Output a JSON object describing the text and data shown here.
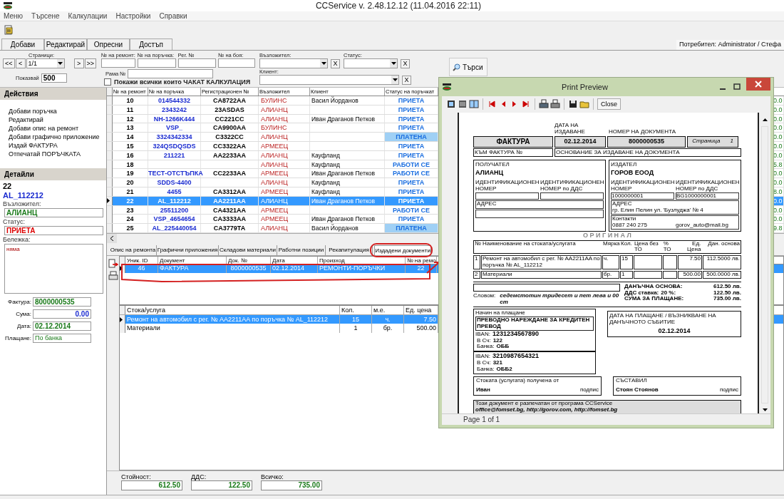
{
  "window": {
    "title": "CCService v. 2.48.12.12 (11.04.2016 22:11)"
  },
  "menu": [
    "Меню",
    "Търсене",
    "Калкулации",
    "Настройки",
    "Справки"
  ],
  "toolbar_tabs": [
    {
      "label": "Добави",
      "selected": false
    },
    {
      "label": "Редактирай",
      "selected": false
    },
    {
      "label": "Опресни",
      "selected": false
    },
    {
      "label": "Достъп",
      "selected": false
    }
  ],
  "user": "Потребител: Administrator / Стефа",
  "filter": {
    "pages_label": "Страници:",
    "page": "1/1",
    "nav": [
      "<<",
      "<",
      ">",
      ">>"
    ],
    "show_label": "Показвай",
    "show": "500",
    "repair_label": "№ на ремонт:",
    "order_label": "№ на поръчка:",
    "reg_label": "Рег. №",
    "paint_label": "№ на боя:",
    "frame_label": "Рама №",
    "assignor_label": "Възложител:",
    "assignor_clear": "X",
    "status_label": "Статус:",
    "status_clear": "X",
    "client_label": "Клиент:",
    "client_clear": "X",
    "waiting": {
      "label": "Покажи всички които ЧАКАТ КАЛКУЛАЦИЯ",
      "checked": false
    },
    "search": "Търси"
  },
  "actions": {
    "title": "Действия",
    "items": [
      "Добави поръчка",
      "Редактирай",
      "Добави опис на ремонт",
      "Добави графично приложение",
      "Издай ФАКТУРА",
      "Отпечатай ПОРЪЧКАТА"
    ]
  },
  "details": {
    "title": "Детайли",
    "repair": "22",
    "order": "AL_112212",
    "assignor_label": "Възложител:",
    "assignor": "АЛИАНЦ",
    "status_label": "Статус:",
    "status": "ПРИЕТА",
    "note_label": "Бележка:",
    "note": "няма",
    "fields": [
      {
        "label": "Фактура:",
        "value": "8000000535",
        "kind": "green"
      },
      {
        "label": "Сума:",
        "value": "0.00",
        "kind": "amount"
      },
      {
        "label": "Дата:",
        "value": "02.12.2014",
        "kind": "green"
      },
      {
        "label": "Плащане:",
        "value": "По банка",
        "kind": "plain"
      }
    ]
  },
  "table": {
    "columns": [
      "№ на ремонт",
      "№ на поръчка",
      "Регистрационен №",
      "Възложител",
      "Клиент",
      "Статус на поръчкат"
    ],
    "rows": [
      {
        "repair": "10",
        "order": "014544332",
        "reg": "CA8722AA",
        "assignor": "БУЛИНС",
        "client": "Васил Йорданов",
        "status": "ПРИЕТА",
        "status_shaded": false,
        "selected": false,
        "column_8": "0.0"
      },
      {
        "repair": "11",
        "order": "2343242",
        "reg": "23ASDAS",
        "assignor": "АЛИАНЦ",
        "status": "ПРИЕТА",
        "status_shaded": false,
        "selected": false,
        "column_8": "0.0"
      },
      {
        "repair": "12",
        "order": "NH-1266K444",
        "reg": "CC221CC",
        "assignor": "АЛИАНЦ",
        "client": "Иван Драганов Петков",
        "status": "ПРИЕТА",
        "status_shaded": false,
        "selected": false,
        "column_8": "0.0"
      },
      {
        "repair": "13",
        "order": "VSP_",
        "reg": "CA9900AA",
        "assignor": "БУЛИНС",
        "status": "ПРИЕТА",
        "status_shaded": false,
        "selected": false,
        "column_8": "0.0"
      },
      {
        "repair": "14",
        "order": "3324342334",
        "reg": "C3322CC",
        "assignor": "АЛИАНЦ",
        "status": "ПЛАТЕНА",
        "status_shaded": true,
        "selected": false,
        "column_8": "0.0"
      },
      {
        "repair": "15",
        "order": "324QSDQSDS",
        "reg": "CC3322AA",
        "assignor": "АРМЕЕЦ",
        "status": "ПРИЕТА",
        "status_shaded": false,
        "selected": false,
        "column_8": "0.0"
      },
      {
        "repair": "16",
        "order": "211221",
        "reg": "AA2233AA",
        "assignor": "АЛИАНЦ",
        "client": "Кауфланд",
        "status": "ПРИЕТА",
        "status_shaded": false,
        "selected": false,
        "column_8": "0.0"
      },
      {
        "repair": "18",
        "assignor": "АЛИАНЦ",
        "client": "Кауфланд",
        "status": "РАБОТИ СЕ",
        "status_shaded": false,
        "selected": false,
        "column_8": "5.8"
      },
      {
        "repair": "19",
        "order": "ТЕСТ-ОТСТЪПКА",
        "reg": "CC2233AA",
        "assignor": "АРМЕЕЦ",
        "client": "Иван Драганов Петков",
        "status": "РАБОТИ СЕ",
        "status_shaded": false,
        "selected": false,
        "column_8": "0.0"
      },
      {
        "repair": "20",
        "order": "SDDS-4400",
        "assignor": "АЛИАНЦ",
        "client": "Кауфланд",
        "status": "ПРИЕТА",
        "status_shaded": false,
        "selected": false,
        "column_8": "0.0"
      },
      {
        "repair": "21",
        "order": "4455",
        "reg": "CA3312AA",
        "assignor": "АРМЕЕЦ",
        "client": "Кауфланд",
        "status": "ПРИЕТА",
        "status_shaded": false,
        "selected": false,
        "column_8": "8.0"
      },
      {
        "repair": "22",
        "order": "AL_112212",
        "reg": "AA2211AA",
        "assignor": "АЛИАНЦ",
        "client": "Иван Драганов Петков",
        "status": "ПРИЕТА",
        "status_shaded": false,
        "selected": true,
        "column_8": "0.0"
      },
      {
        "repair": "23",
        "order": "25511200",
        "reg": "CA4321AA",
        "assignor": "АРМЕЕЦ",
        "status": "РАБОТИ СЕ",
        "status_shaded": false,
        "selected": false,
        "column_8": "0.0"
      },
      {
        "repair": "24",
        "order": "VSP_4654654",
        "reg": "CA3333AA",
        "assignor": "АРМЕЕЦ",
        "client": "Иван Драганов Петков",
        "status": "ПРИЕТА",
        "status_shaded": false,
        "selected": false,
        "column_8": "0.0"
      },
      {
        "repair": "25",
        "order": "AL_225440054",
        "reg": "CA3779TA",
        "assignor": "АЛИАНЦ",
        "client": "Васил Йорданов",
        "status": "ПЛАТЕНА",
        "status_shaded": true,
        "selected": false,
        "column_8": "9.8"
      }
    ]
  },
  "subtabs": [
    {
      "label": "Опис на ремонта",
      "selected": false
    },
    {
      "label": "Графични приложения",
      "selected": false
    },
    {
      "label": "Складови материали",
      "selected": false
    },
    {
      "label": "Работни позиции",
      "selected": false
    },
    {
      "label": "Рекапитулация",
      "selected": false
    },
    {
      "label": "Издадени документи",
      "selected": true
    }
  ],
  "documents": {
    "columns": [
      "Уник. ID",
      "Документ",
      "Док. №",
      "Дата",
      "Произход",
      "№ на ремо"
    ],
    "rows": [
      {
        "cells": [
          "46",
          "ФАКТУРА",
          "8000000535",
          "02.12.2014",
          "РЕМОНТИ-ПОРЪЧКИ",
          "22"
        ],
        "selected": true
      }
    ]
  },
  "items": {
    "columns": [
      "Стока/услуга",
      "Кол.",
      "м.е.",
      "Ед. цена"
    ],
    "rows": [
      {
        "cells": [
          "Ремонт на автомобил с рег. № AA2211AA по поръчка № AL_112212",
          "15",
          "ч.",
          "7.50"
        ],
        "selected": true
      },
      {
        "cells": [
          "Материали",
          "1",
          "бр.",
          "500.00"
        ],
        "selected": false
      }
    ]
  },
  "totals": [
    {
      "label": "Стойност:",
      "value": "612.50"
    },
    {
      "label": "ДДС:",
      "value": "122.50"
    },
    {
      "label": "Всичко:",
      "value": "735.00"
    }
  ],
  "preview": {
    "title": "Print Preview",
    "close": "Close",
    "status": "Page 1 of 1",
    "invoice": {
      "date_label": "ДАТА НА ИЗДАВАНЕ",
      "number_label": "НОМЕР НА ДОКУМЕНТА",
      "title": "ФАКТУРА",
      "date": "02.12.2014",
      "number": "8000000535",
      "page_label": "Страница",
      "page": "1",
      "ref_label": "КЪМ ФАКТУРА №",
      "basis_label": "ОСНОВАНИЕ ЗА ИЗДАВАНЕ НА ДОКУМЕНТА",
      "recipient": {
        "label": "ПОЛУЧАТЕЛ",
        "name": "АЛИАНЦ",
        "id_label": "ИДЕНТИФИКАЦИОНЕН НОМЕР",
        "vat_label": "ИДЕНТИФИКАЦИОНЕН НОМЕР по ДДС",
        "address_label": "АДРЕС"
      },
      "issuer": {
        "label": "ИЗДАТЕЛ",
        "name": "ГОРОВ ЕООД",
        "id_label": "ИДЕНТИФИКАЦИОНЕН НОМЕР",
        "vat_label": "ИДЕНТИФИКАЦИОНЕН НОМЕР по ДДС",
        "id": "1000000001",
        "vat": "BG1000000001",
        "address_label": "АДРЕС",
        "address": "гр. Елин Пелин    ул. 'Бузлуджа' № 4",
        "contacts_label": "Контакти",
        "phone": "0887 240 275",
        "email": "gorov_auto@mail.bg"
      },
      "copy": "О Р И Г И Н А Л",
      "columns": [
        "№",
        "Наименование на стоката/услугата",
        "Мярка",
        "Кол.",
        "Цена без ТО",
        "% ТО",
        "Ед. Цена",
        "Дан. основа"
      ],
      "lines": [
        {
          "no": "1",
          "name": "Ремонт на автомобил с рег. № AA2211AA по поръчка № AL_112212",
          "unit": "ч.",
          "qty": "15",
          "price": "7.50",
          "base": "112.5000 лв."
        },
        {
          "no": "2",
          "name": "Материали",
          "unit": "бр.",
          "qty": "1",
          "price": "500.00",
          "base": "500.0000 лв."
        }
      ],
      "sums": [
        {
          "label": "ДАНЪЧНА ОСНОВА:",
          "value": "612.50 лв."
        },
        {
          "label": "ДДС ставка:",
          "rate": "20 %:",
          "value": "122.50 лв."
        },
        {
          "label": "СУМА ЗА ПЛАЩАНЕ:",
          "value": "735.00 лв."
        }
      ],
      "words_label": "Словом:",
      "words": "седемстотин тридесет и пет лева и 00 ст",
      "payment_label": "Начин на плащане",
      "payment": "ПРЕВОДНО НАРЕЖДАНЕ ЗА КРЕДИТЕН ПРЕВОД",
      "accounts": [
        {
          "iban_label": "IBAN:",
          "iban": "1231234567890",
          "code_label": "В Сч:",
          "code": "122",
          "bank_label": "Банка:",
          "bank": "ОББ"
        },
        {
          "iban_label": "IBAN:",
          "iban": "3210987654321",
          "code_label": "В Сч:",
          "code": "321",
          "bank_label": "Банка:",
          "bank": "ОББ2"
        }
      ],
      "paydate_label": "ДАТА НА ПЛАЩАНЕ / ВЪЗНИКВАНЕ НА ДАНЪЧНОТО СЪБИТИЕ",
      "paydate": "02.12.2014",
      "received_label": "Стоката (услугата) получена от",
      "received": "Иван",
      "received_sign": "подпис",
      "composed_label": "СЪСТАВИЛ",
      "composed": "Стоян Стоянов",
      "composed_sign": "подпис",
      "footer_left": "Този документ е разпечатан от програма CCService",
      "footer_right": "office@fomset.bg, http://gorov.com, http://fomset.bg"
    }
  }
}
